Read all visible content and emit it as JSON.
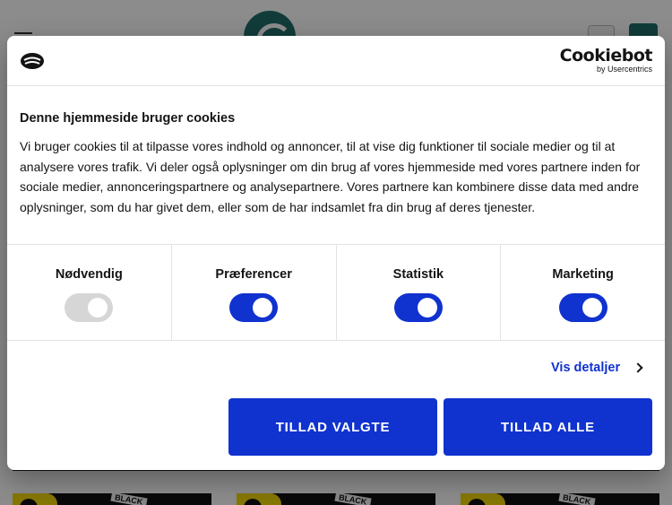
{
  "dialog": {
    "brand": {
      "name": "Cookiebot",
      "sub": "by Usercentrics"
    },
    "title": "Denne hjemmeside bruger cookies",
    "text": "Vi bruger cookies til at tilpasse vores indhold og annoncer, til at vise dig funktioner til sociale medier og til at analysere vores trafik. Vi deler også oplysninger om din brug af vores hjemmeside med vores partnere inden for sociale medier, annonceringspartnere og analysepartnere. Vores partnere kan kombinere disse data med andre oplysninger, som du har givet dem, eller som de har indsamlet fra din brug af deres tjenester.",
    "categories": [
      {
        "label": "Nødvendig",
        "checked": true,
        "disabled": true
      },
      {
        "label": "Præferencer",
        "checked": true,
        "disabled": false
      },
      {
        "label": "Statistik",
        "checked": true,
        "disabled": false
      },
      {
        "label": "Marketing",
        "checked": true,
        "disabled": false
      }
    ],
    "details_link": "Vis detaljer",
    "btn_selected": "TILLAD VALGTE",
    "btn_all": "TILLAD ALLE"
  },
  "background": {
    "thumbnail_tape": "BLACK"
  },
  "colors": {
    "accent": "#1032cf",
    "toggle_disabled": "#d6d6d6",
    "site_brand": "#1f6d6b"
  }
}
